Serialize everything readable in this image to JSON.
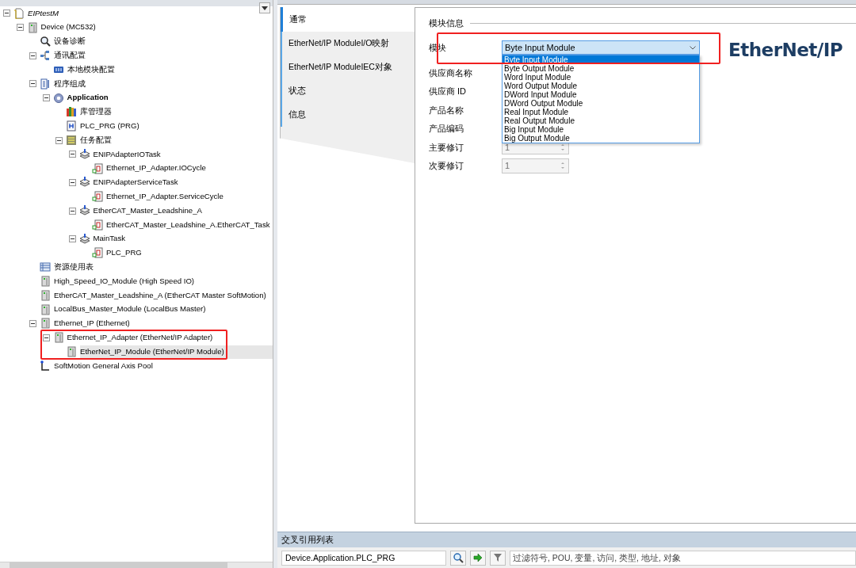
{
  "tree": [
    {
      "label": "EIPtestM",
      "kind": "project",
      "expanded": true,
      "selected": false,
      "children": [
        {
          "label": "Device (MC532)",
          "kind": "device",
          "expanded": true,
          "selected": false,
          "children": [
            {
              "label": "设备诊断",
              "kind": "diagnosis",
              "selected": false
            },
            {
              "label": "通讯配置",
              "kind": "network",
              "expanded": true,
              "selected": false,
              "children": [
                {
                  "label": "本地模块配置",
                  "kind": "rack",
                  "selected": false
                }
              ]
            },
            {
              "label": "程序组成",
              "kind": "program",
              "expanded": true,
              "selected": false,
              "children": [
                {
                  "label": "Application",
                  "kind": "application",
                  "expanded": true,
                  "selected": false,
                  "children": [
                    {
                      "label": "库管理器",
                      "kind": "library",
                      "selected": false
                    },
                    {
                      "label": "PLC_PRG (PRG)",
                      "kind": "pou",
                      "selected": false
                    },
                    {
                      "label": "任务配置",
                      "kind": "taskconfig",
                      "expanded": true,
                      "selected": false,
                      "children": [
                        {
                          "label": "ENIPAdapterIOTask",
                          "kind": "task",
                          "expanded": true,
                          "selected": false,
                          "children": [
                            {
                              "label": "Ethernet_IP_Adapter.IOCycle",
                              "kind": "call",
                              "selected": false
                            }
                          ]
                        },
                        {
                          "label": "ENIPAdapterServiceTask",
                          "kind": "task",
                          "expanded": true,
                          "selected": false,
                          "children": [
                            {
                              "label": "Ethernet_IP_Adapter.ServiceCycle",
                              "kind": "call",
                              "selected": false
                            }
                          ]
                        },
                        {
                          "label": "EtherCAT_Master_Leadshine_A",
                          "kind": "task",
                          "expanded": true,
                          "selected": false,
                          "children": [
                            {
                              "label": "EtherCAT_Master_Leadshine_A.EtherCAT_Task",
                              "kind": "call",
                              "selected": false
                            }
                          ]
                        },
                        {
                          "label": "MainTask",
                          "kind": "task",
                          "expanded": true,
                          "selected": false,
                          "children": [
                            {
                              "label": "PLC_PRG",
                              "kind": "call",
                              "selected": false
                            }
                          ]
                        }
                      ]
                    }
                  ]
                }
              ]
            },
            {
              "label": "资源使用表",
              "kind": "table",
              "selected": false
            },
            {
              "label": "High_Speed_IO_Module (High Speed IO)",
              "kind": "device",
              "selected": false
            },
            {
              "label": "EtherCAT_Master_Leadshine_A (EtherCAT Master SoftMotion)",
              "kind": "device",
              "selected": false
            },
            {
              "label": "LocalBus_Master_Module (LocalBus Master)",
              "kind": "device",
              "selected": false
            },
            {
              "label": "Ethernet_IP (Ethernet)",
              "kind": "device",
              "expanded": true,
              "selected": false,
              "children": [
                {
                  "label": "Ethernet_IP_Adapter (EtherNet/IP Adapter)",
                  "kind": "device",
                  "expanded": true,
                  "selected": false,
                  "outlined": true,
                  "children": [
                    {
                      "label": "EtherNet_IP_Module (EtherNet/IP Module)",
                      "kind": "device",
                      "selected": true
                    }
                  ]
                }
              ]
            },
            {
              "label": "SoftMotion General Axis Pool",
              "kind": "axis",
              "selected": false
            }
          ]
        }
      ]
    }
  ],
  "tabs": [
    {
      "label": "通常",
      "selected": true
    },
    {
      "label": "EtherNet/IP ModuleI/O映射",
      "selected": false
    },
    {
      "label": "EtherNet/IP ModuleIEC对象",
      "selected": false
    },
    {
      "label": "状态",
      "selected": false
    },
    {
      "label": "信息",
      "selected": false
    }
  ],
  "module_info": {
    "heading": "模块信息",
    "logo": "EtherNet/IP",
    "fields": [
      {
        "label": "模块",
        "kind": "dropdown",
        "value": "Byte Input Module",
        "expanded": true,
        "outlined": true,
        "options": [
          {
            "label": "Byte Input Module",
            "selected": true
          },
          {
            "label": "Byte Output Module",
            "selected": false
          },
          {
            "label": "Word Input Module",
            "selected": false
          },
          {
            "label": "Word Output Module",
            "selected": false
          },
          {
            "label": "DWord Input Module",
            "selected": false
          },
          {
            "label": "DWord Output Module",
            "selected": false
          },
          {
            "label": "Real Input Module",
            "selected": false
          },
          {
            "label": "Real Output Module",
            "selected": false
          },
          {
            "label": "Big Input Module",
            "selected": false
          },
          {
            "label": "Big Output Module",
            "selected": false
          }
        ]
      },
      {
        "label": "供应商名称",
        "kind": "covered"
      },
      {
        "label": "供应商 ID",
        "kind": "covered"
      },
      {
        "label": "产品名称",
        "kind": "covered"
      },
      {
        "label": "产品编码",
        "kind": "covered"
      },
      {
        "label": "主要修订",
        "kind": "spin",
        "value": "1",
        "disabled": true
      },
      {
        "label": "次要修订",
        "kind": "spin",
        "value": "1",
        "disabled": true
      }
    ]
  },
  "cross_reference": {
    "title": "交叉引用列表",
    "path": "Device.Application.PLC_PRG",
    "filter_placeholder": "过滤符号, POU, 变量, 访问, 类型, 地址, 对象"
  }
}
